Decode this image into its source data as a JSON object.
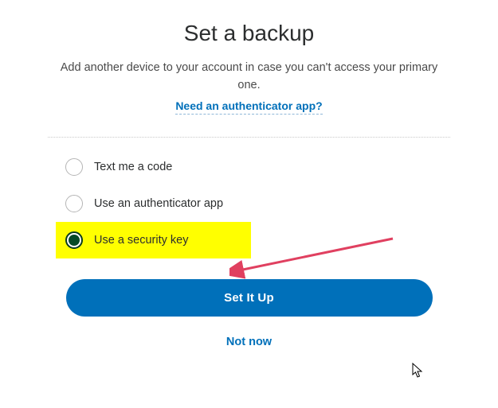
{
  "header": {
    "title": "Set a backup",
    "subtitle": "Add another device to your account in case you can't access your primary one.",
    "help_link": "Need an authenticator app?"
  },
  "options": [
    {
      "label": "Text me a code",
      "selected": false,
      "highlighted": false
    },
    {
      "label": "Use an authenticator app",
      "selected": false,
      "highlighted": false
    },
    {
      "label": "Use a security key",
      "selected": true,
      "highlighted": true
    }
  ],
  "actions": {
    "primary": "Set It Up",
    "secondary": "Not now"
  },
  "annotation": {
    "arrow_color": "#e04060"
  }
}
